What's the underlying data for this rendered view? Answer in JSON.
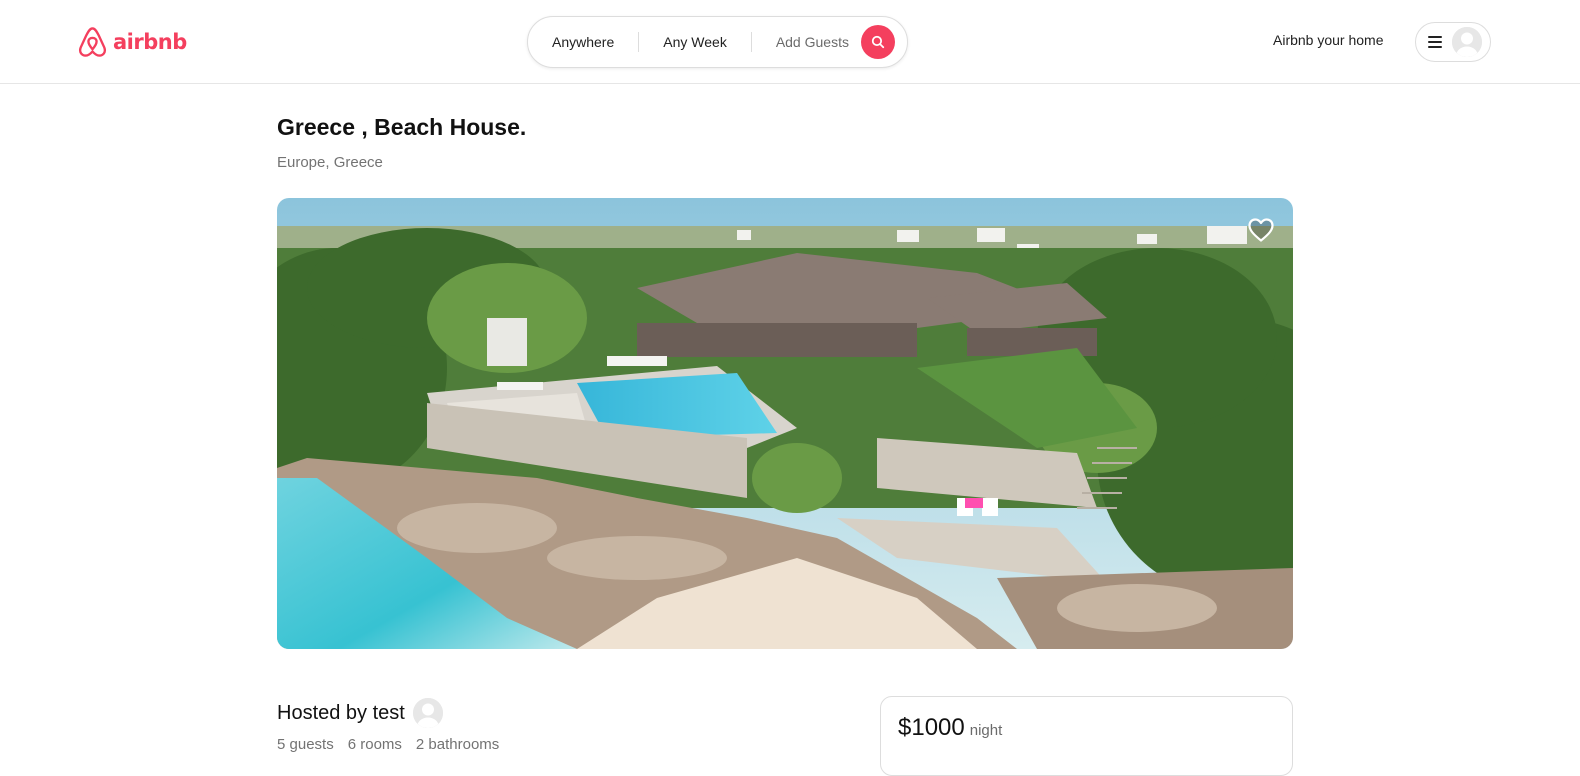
{
  "header": {
    "logo_text": "airbnb",
    "search": {
      "location": "Anywhere",
      "dates": "Any Week",
      "guests": "Add Guests"
    },
    "host_link": "Airbnb your home"
  },
  "listing": {
    "title": "Greece , Beach House.",
    "location": "Europe, Greece",
    "hosted_by": "Hosted by test",
    "stats": [
      "5 guests",
      "6 rooms",
      "2 bathrooms"
    ],
    "price": "$1000",
    "price_unit": "night"
  },
  "colors": {
    "brand": "#f43f5e",
    "text": "#222222",
    "muted": "#737373",
    "border": "#dddddd"
  },
  "icons": {
    "logo": "airbnb-logo-icon",
    "search": "search-icon",
    "menu": "hamburger-menu-icon",
    "avatar": "user-avatar-icon",
    "favorite": "heart-icon"
  }
}
